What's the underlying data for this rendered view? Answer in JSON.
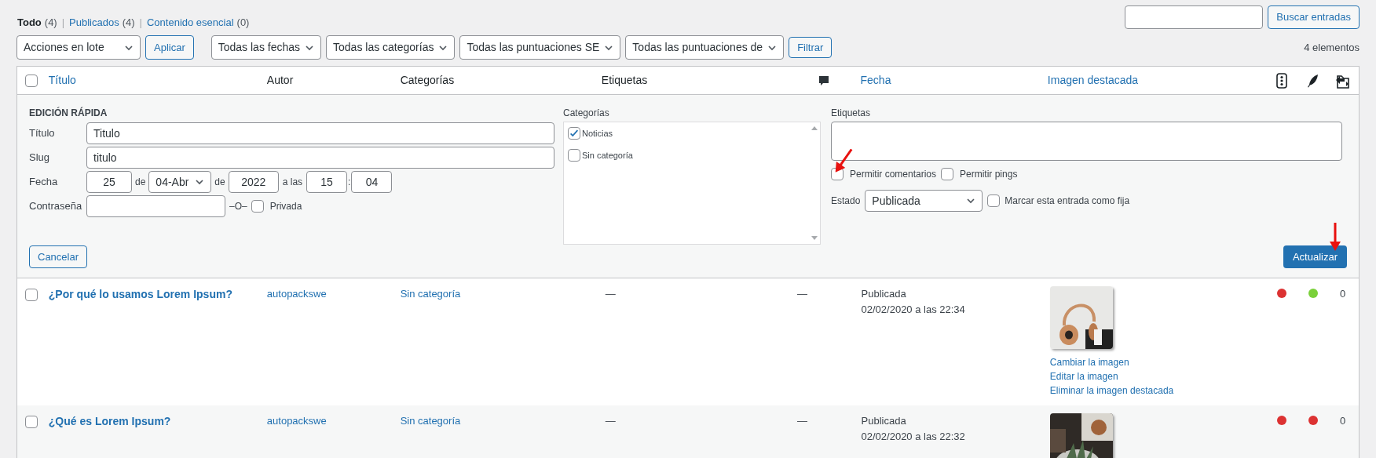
{
  "view_separator": "|",
  "views": [
    {
      "label": "Todo",
      "count": "(4)",
      "selected": true
    },
    {
      "label": "Publicados",
      "count": "(4)",
      "selected": false
    },
    {
      "label": "Contenido esencial",
      "count": "(0)",
      "selected": false
    }
  ],
  "search": {
    "button": "Buscar entradas"
  },
  "bulk_actions": {
    "value": "Acciones en lote",
    "apply": "Aplicar"
  },
  "filters": [
    "Todas las fechas",
    "Todas las categorías",
    "Todas las puntuaciones SE",
    "Todas las puntuaciones de"
  ],
  "filter_button": "Filtrar",
  "item_count": "4 elementos",
  "select_all": {
    "checked": false
  },
  "columns": [
    {
      "kind": "link",
      "label": "Título"
    },
    {
      "kind": "text",
      "label": "Autor"
    },
    {
      "kind": "text",
      "label": "Categorías"
    },
    {
      "kind": "text",
      "label": "Etiquetas"
    },
    {
      "kind": "comments"
    },
    {
      "kind": "link",
      "label": "Fecha"
    },
    {
      "kind": "link",
      "label": "Imagen destacada"
    },
    {
      "kind": "readability"
    },
    {
      "kind": "seo"
    },
    {
      "kind": "links"
    }
  ],
  "quick_edit": {
    "heading": "EDICIÓN RÁPIDA",
    "title_label": "Título",
    "title": "Titulo",
    "slug_label": "Slug",
    "slug": "titulo",
    "date_label": "Fecha",
    "day": "25",
    "of_1": "de",
    "month": "04-Abr",
    "of_2": "de",
    "year": "2022",
    "at": "a las",
    "hour": "15",
    "colon": ":",
    "minute": "04",
    "password_label": "Contraseña",
    "or": "–O–",
    "private": {
      "label": "Privada",
      "checked": false
    },
    "categories_label": "Categorías",
    "categories": [
      {
        "label": "Noticias",
        "checked": true
      },
      {
        "label": "Sin categoría",
        "checked": false
      }
    ],
    "tags_label": "Etiquetas",
    "allow_comments": {
      "label": "Permitir comentarios",
      "checked": false
    },
    "allow_pings": {
      "label": "Permitir pings",
      "checked": false
    },
    "status_label": "Estado",
    "status": "Publicada",
    "sticky": {
      "label": "Marcar esta entrada como fija",
      "checked": false
    },
    "cancel": "Cancelar",
    "update": "Actualizar"
  },
  "rows": [
    {
      "checked": false,
      "title": "¿Por qué lo usamos Lorem Ipsum?",
      "author": "autopackswe",
      "category": "Sin categoría",
      "tags": "—",
      "comments": "—",
      "status": "Publicada",
      "date": "02/02/2020 a las 22:34",
      "image": {
        "kind": "picture"
      },
      "image_actions": [
        "Cambiar la imagen",
        "Editar la imagen",
        "Eliminar la imagen destacada"
      ],
      "readability": {
        "color": "#dc3232"
      },
      "seo": {
        "color": "#7ad03a"
      },
      "links": "0"
    },
    {
      "checked": false,
      "title": "¿Qué es Lorem Ipsum?",
      "author": "autopackswe",
      "category": "Sin categoría",
      "tags": "—",
      "comments": "—",
      "status": "Publicada",
      "date": "02/02/2020 a las 22:32",
      "image": {
        "kind": "picture"
      },
      "readability": {
        "color": "#dc3232"
      },
      "seo": {
        "color": "#dc3232"
      },
      "links": "0"
    }
  ]
}
